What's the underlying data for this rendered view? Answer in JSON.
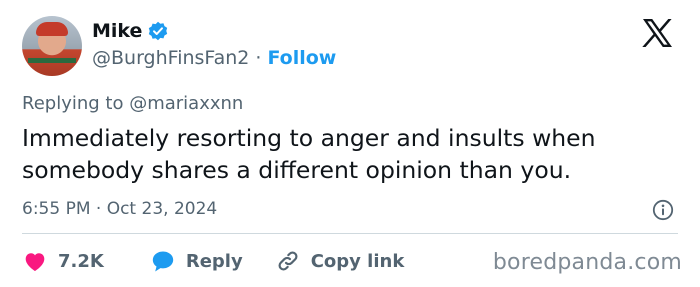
{
  "author": {
    "name": "Mike",
    "handle": "@BurghFinsFan2",
    "follow_label": "Follow",
    "separator": "·"
  },
  "reply_prefix": "Replying to",
  "reply_to_handle": "@mariaxxnn",
  "tweet": {
    "line1": "Immediately resorting to anger and insults when",
    "line2": "somebody shares a different opinion than you."
  },
  "timestamp": "6:55 PM · Oct 23, 2024",
  "actions": {
    "likes_count": "7.2K",
    "reply_label": "Reply",
    "copy_link_label": "Copy link"
  },
  "watermark": "boredpanda.com",
  "colors": {
    "accent": "#1d9bf0",
    "like": "#f91880",
    "text": "#0f1419",
    "muted": "#536471"
  },
  "icons": {
    "verified": "verified-badge-icon",
    "logo": "x-logo-icon",
    "info": "info-icon",
    "like": "heart-icon",
    "reply": "speech-bubble-icon",
    "copy_link": "link-icon"
  }
}
